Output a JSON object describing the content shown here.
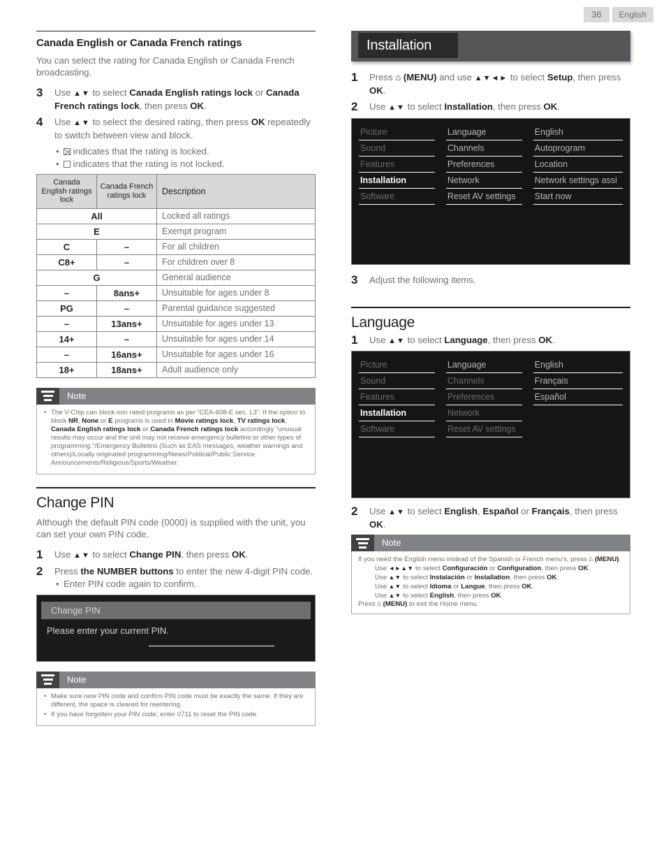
{
  "header": {
    "page_number": "36",
    "language": "English"
  },
  "left": {
    "section1": {
      "title": "Canada English or Canada French ratings",
      "intro": "You can select the rating for Canada English or Canada French broadcasting.",
      "steps": [
        {
          "num": "3",
          "html": "Use <span class='arw'>▲▼</span> to select <b>Canada English ratings lock</b> or <b>Canada French ratings lock</b>, then press <b>OK</b>."
        },
        {
          "num": "4",
          "html": "Use <span class='arw'>▲▼</span> to select the desired rating, then press <b>OK</b> repeatedly to switch between view and block."
        }
      ],
      "bullets": [
        {
          "icon": "checkbox-checked",
          "text": "indicates that the rating is locked."
        },
        {
          "icon": "checkbox-empty",
          "text": "indicates that the rating is not locked."
        }
      ],
      "table": {
        "headers": [
          "Canada English ratings lock",
          "Canada French ratings lock",
          "Description"
        ],
        "rows": [
          {
            "span": true,
            "english": "All",
            "french": "",
            "description": "Locked all ratings"
          },
          {
            "span": true,
            "english": "E",
            "french": "",
            "description": "Exempt program"
          },
          {
            "span": false,
            "english": "C",
            "french": "–",
            "description": "For all children"
          },
          {
            "span": false,
            "english": "C8+",
            "french": "–",
            "description": "For children over 8"
          },
          {
            "span": true,
            "english": "G",
            "french": "",
            "description": "General audience"
          },
          {
            "span": false,
            "english": "–",
            "french": "8ans+",
            "description": "Unsuitable for ages under 8"
          },
          {
            "span": false,
            "english": "PG",
            "french": "–",
            "description": "Parental guidance suggested"
          },
          {
            "span": false,
            "english": "–",
            "french": "13ans+",
            "description": "Unsuitable for ages under 13"
          },
          {
            "span": false,
            "english": "14+",
            "french": "–",
            "description": "Unsuitable for ages under 14"
          },
          {
            "span": false,
            "english": "–",
            "french": "16ans+",
            "description": "Unsuitable for ages under 16"
          },
          {
            "span": false,
            "english": "18+",
            "french": "18ans+",
            "description": "Adult audience only"
          }
        ]
      },
      "note": {
        "title": "Note",
        "items": [
          "The V-Chip can block non rated programs as per “CEA-608-E sec. L3”. If the option to block <b>NR</b>, <b>None</b> or <b>E</b> programs is used in <b>Movie ratings lock</b>, <b>TV ratings lock</b>, <b>Canada English ratings lock</b> or <b>Canada French ratings lock</b> accordingly “unusual results may occur and the unit may not receive emergency bulletins or other types of programming.”/Emergency Bulletins (Such as EAS messages, weather warnings and others)/Locally originated programming/News/Political/Public Service Announcements/Religious/Sports/Weather."
        ]
      }
    },
    "section2": {
      "title": "Change PIN",
      "intro": "Although the default PIN code (0000) is supplied with the unit, you can set your own PIN code.",
      "steps": [
        {
          "num": "1",
          "html": "Use <span class='arw'>▲▼</span> to select <b>Change PIN</b>, then press <b>OK</b>."
        },
        {
          "num": "2",
          "html": "Press <b>the NUMBER buttons</b> to enter the new 4-digit PIN code."
        }
      ],
      "substep": "Enter PIN code again to confirm.",
      "dialog": {
        "title": "Change PIN",
        "message": "Please enter your current PIN.",
        "input_value": ""
      },
      "note": {
        "title": "Note",
        "items": [
          "Make sure new PIN code and confirm PIN code must be exactly the same. If they are different, the space is cleared for reentering.",
          "If you have forgotten your PIN code, enter 0711 to reset the PIN code."
        ]
      }
    }
  },
  "right": {
    "banner": {
      "title": "Installation"
    },
    "steps_top": [
      {
        "num": "1",
        "html": "Press <span class='home'>⌂</span> <b>(MENU)</b> and use <span class='arw'>▲▼◄►</span> to select <b>Setup</b>, then press <b>OK</b>."
      },
      {
        "num": "2",
        "html": "Use <span class='arw'>▲▼</span> to select <b>Installation</b>, then press <b>OK</b>."
      }
    ],
    "menu1": {
      "col1": [
        {
          "label": "Picture",
          "state": "dim"
        },
        {
          "label": "Sound",
          "state": "dim"
        },
        {
          "label": "Features",
          "state": "dim"
        },
        {
          "label": "Installation",
          "state": "sel"
        },
        {
          "label": "Software",
          "state": "dim"
        }
      ],
      "col2": [
        {
          "label": "Language",
          "state": "normal"
        },
        {
          "label": "Channels",
          "state": "normal"
        },
        {
          "label": "Preferences",
          "state": "normal"
        },
        {
          "label": "Network",
          "state": "normal"
        },
        {
          "label": "Reset AV settings",
          "state": "normal"
        }
      ],
      "col3": [
        {
          "label": "English",
          "state": "normal"
        },
        {
          "label": "Autoprogram",
          "state": "normal"
        },
        {
          "label": "Location",
          "state": "normal"
        },
        {
          "label": "Network settings assi",
          "state": "normal"
        },
        {
          "label": "Start now",
          "state": "normal"
        }
      ]
    },
    "step3": {
      "num": "3",
      "html": "Adjust the following items."
    },
    "language_section": {
      "title": "Language",
      "step1": {
        "num": "1",
        "html": "Use <span class='arw'>▲▼</span> to select <b>Language</b>, then press <b>OK</b>."
      },
      "menu2": {
        "col1": [
          {
            "label": "Picture",
            "state": "dim"
          },
          {
            "label": "Sound",
            "state": "dim"
          },
          {
            "label": "Features",
            "state": "dim"
          },
          {
            "label": "Installation",
            "state": "sel"
          },
          {
            "label": "Software",
            "state": "dim"
          }
        ],
        "col2": [
          {
            "label": "Language",
            "state": "normal"
          },
          {
            "label": "Channels",
            "state": "dim"
          },
          {
            "label": "Preferences",
            "state": "dim"
          },
          {
            "label": "Network",
            "state": "dim"
          },
          {
            "label": "Reset AV settings",
            "state": "dim"
          }
        ],
        "col3": [
          {
            "label": "English",
            "state": "normal"
          },
          {
            "label": "Français",
            "state": "normal"
          },
          {
            "label": "Español",
            "state": "normal"
          }
        ]
      },
      "step2": {
        "num": "2",
        "html": "Use <span class='arw'>▲▼</span> to select <b>English</b>, <b>Español</b> or <b>Français</b>, then press <b>OK</b>."
      },
      "note": {
        "title": "Note",
        "lines": [
          {
            "indent": false,
            "html": "If you need the English menu instead of the Spanish or French menu’s, press <span class='home'>⌂</span> <b>(MENU)</b>."
          },
          {
            "indent": true,
            "html": "Use <span class='arw'>◄►▲▼</span> to select <b>Configuración</b> or <b>Configuration</b>, then press <b>OK</b>."
          },
          {
            "indent": true,
            "html": "Use <span class='arw'>▲▼</span> to select <b>Instalación</b> or <b>Installation</b>, then press <b>OK</b>."
          },
          {
            "indent": true,
            "html": "Use <span class='arw'>▲▼</span> to select <b>Idioma</b> or <b>Langue</b>, then press <b>OK</b>."
          },
          {
            "indent": true,
            "html": "Use <span class='arw'>▲▼</span> to select <b>English</b>, then press <b>OK</b>."
          },
          {
            "indent": false,
            "html": "Press <span class='home'>⌂</span> <b>(MENU)</b> to exit the Home menu."
          }
        ]
      }
    }
  }
}
